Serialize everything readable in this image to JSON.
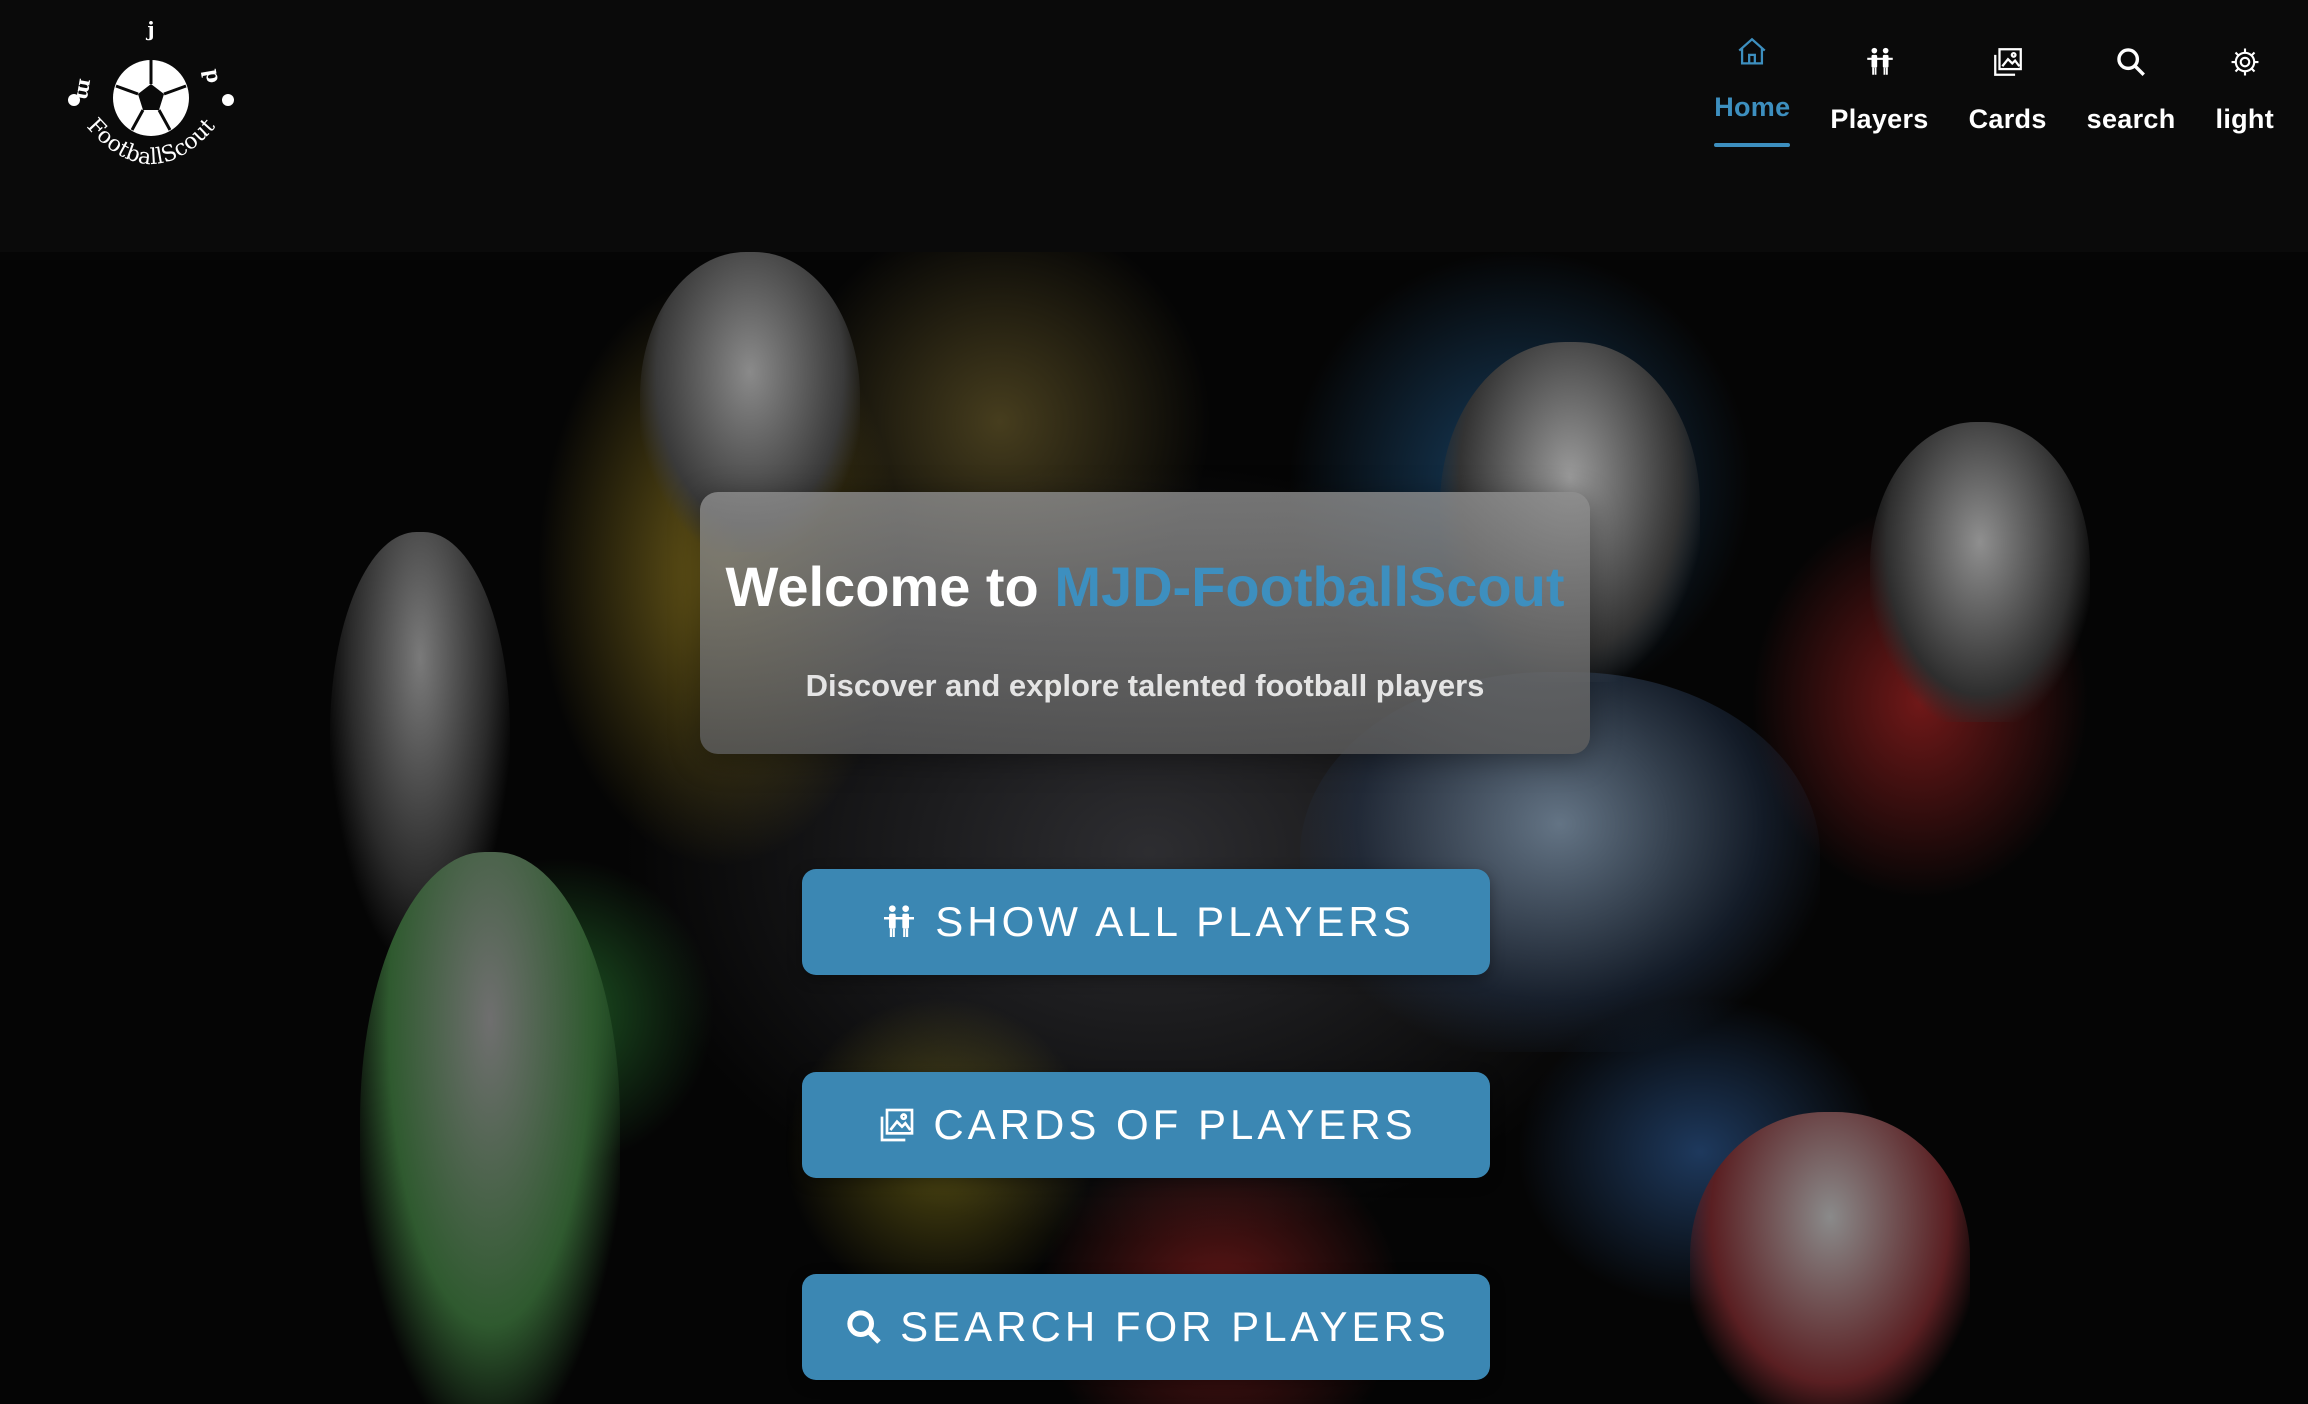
{
  "logo": {
    "text": "FootballScout",
    "letters": [
      "j",
      "m",
      "d"
    ]
  },
  "nav": {
    "items": [
      {
        "label": "Home",
        "icon": "home-icon",
        "active": true
      },
      {
        "label": "Players",
        "icon": "players-icon",
        "active": false
      },
      {
        "label": "Cards",
        "icon": "cards-icon",
        "active": false
      },
      {
        "label": "search",
        "icon": "search-icon",
        "active": false
      },
      {
        "label": "light",
        "icon": "gear-icon",
        "active": false
      }
    ]
  },
  "hero": {
    "title_prefix": "Welcome to ",
    "title_brand": "MJD-FootballScout",
    "subtitle": "Discover and explore talented football players",
    "buttons": [
      {
        "label": "SHOW ALL PLAYERS",
        "icon": "players-icon"
      },
      {
        "label": "CARDS OF PLAYERS",
        "icon": "cards-icon"
      },
      {
        "label": "SEARCH FOR PLAYERS",
        "icon": "search-icon"
      }
    ]
  },
  "colors": {
    "accent": "#3d8fbf",
    "button": "#3b87b3",
    "header_bg": "#0a0a0a"
  }
}
